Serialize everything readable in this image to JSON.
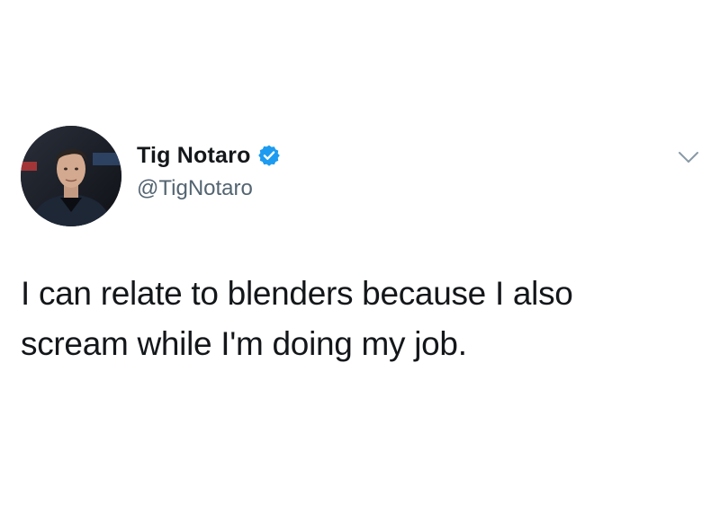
{
  "tweet": {
    "author": {
      "display_name": "Tig Notaro",
      "handle": "@TigNotaro",
      "verified": true,
      "avatar": "profile-photo"
    },
    "text_lines": [
      "I can relate to blenders because I also",
      "scream while I'm doing my job."
    ],
    "menu_icon": "chevron-down-icon"
  },
  "colors": {
    "background": "#ffffff",
    "text": "#14171a",
    "handle": "#536471",
    "verified_badge": "#1d9bf0",
    "chevron": "#8899a6"
  }
}
